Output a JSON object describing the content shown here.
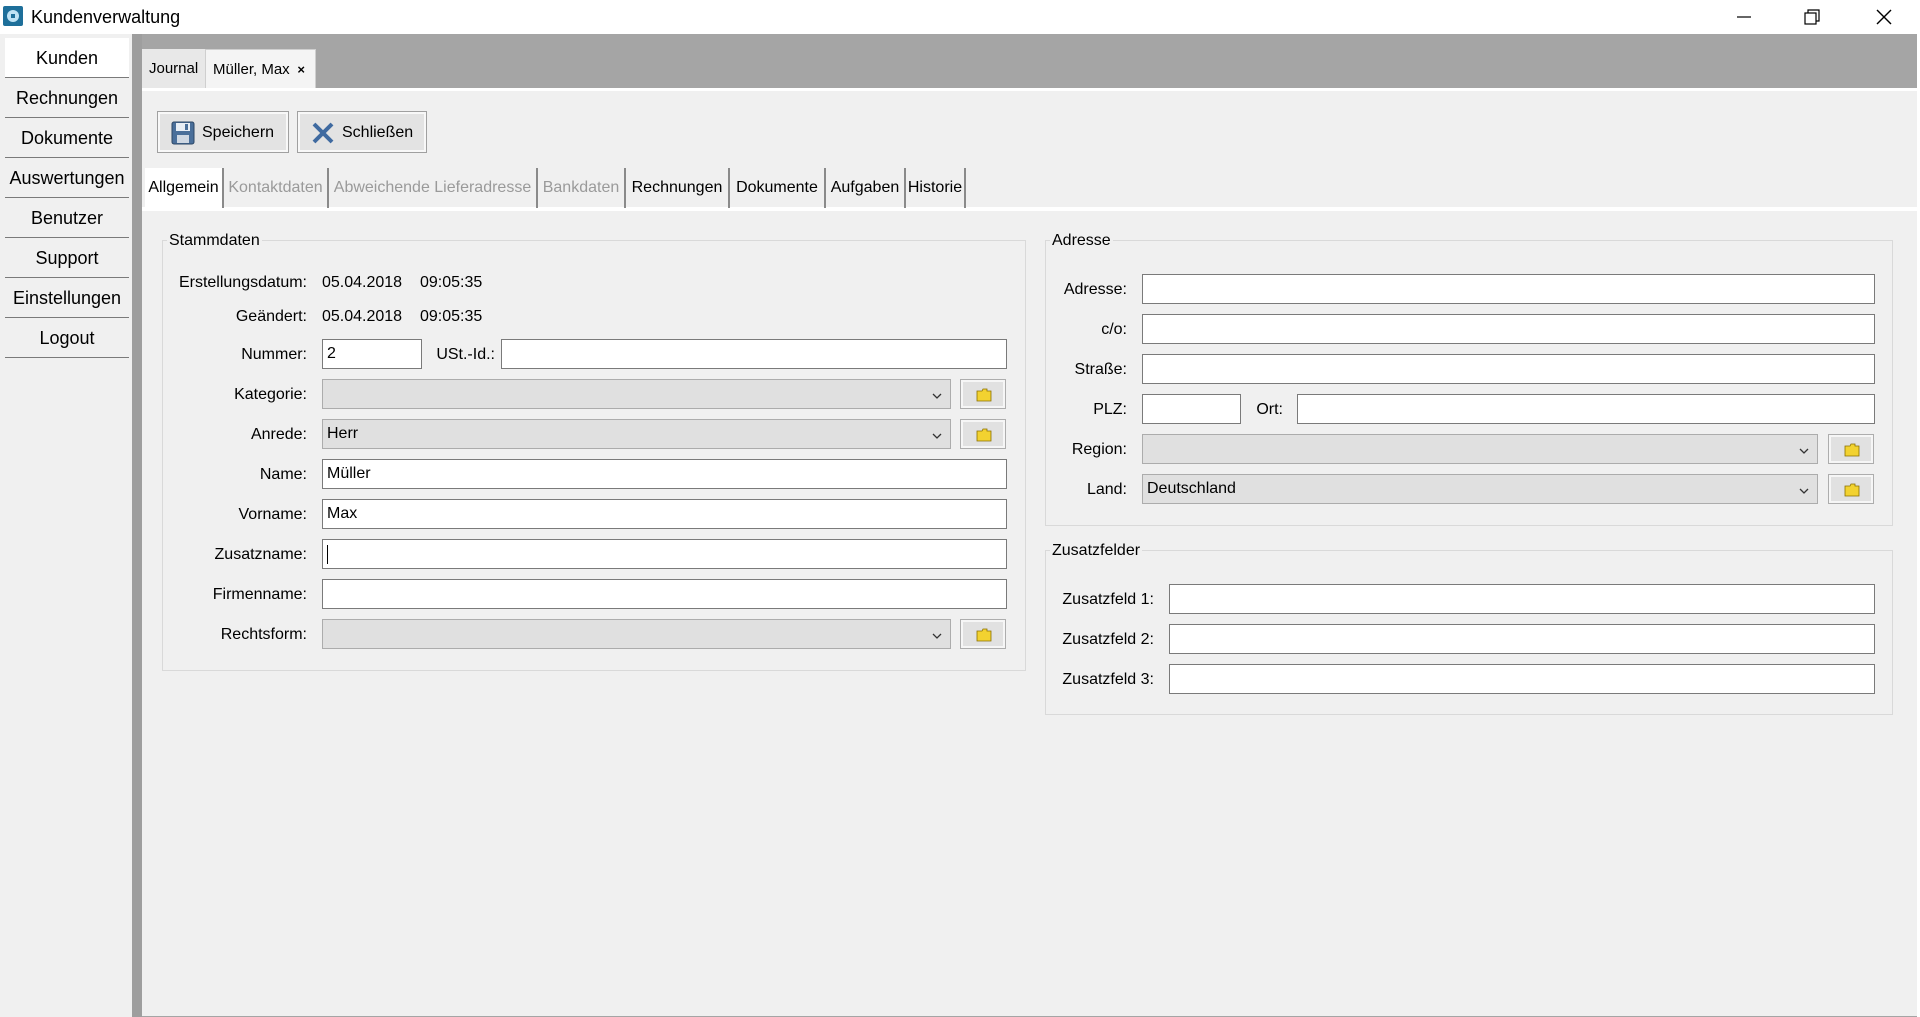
{
  "window": {
    "title": "Kundenverwaltung"
  },
  "nav": {
    "items": [
      {
        "label": "Kunden"
      },
      {
        "label": "Rechnungen"
      },
      {
        "label": "Dokumente"
      },
      {
        "label": "Auswertungen"
      },
      {
        "label": "Benutzer"
      },
      {
        "label": "Support"
      },
      {
        "label": "Einstellungen"
      },
      {
        "label": "Logout"
      }
    ]
  },
  "doc_tabs": {
    "journal": "Journal",
    "active": "Müller, Max",
    "close_glyph": "×"
  },
  "toolbar": {
    "save_label": "Speichern",
    "close_label": "Schließen"
  },
  "sub_tabs": [
    {
      "label": "Allgemein",
      "state": "active"
    },
    {
      "label": "Kontaktdaten",
      "state": "disabled"
    },
    {
      "label": "Abweichende Lieferadresse",
      "state": "disabled"
    },
    {
      "label": "Bankdaten",
      "state": "disabled"
    },
    {
      "label": "Rechnungen",
      "state": "enabled"
    },
    {
      "label": "Dokumente",
      "state": "enabled"
    },
    {
      "label": "Aufgaben",
      "state": "enabled"
    },
    {
      "label": "Historie",
      "state": "enabled"
    }
  ],
  "stammdaten": {
    "title": "Stammdaten",
    "created_label": "Erstellungsdatum:",
    "created_date": "05.04.2018",
    "created_time": "09:05:35",
    "changed_label": "Geändert:",
    "changed_date": "05.04.2018",
    "changed_time": "09:05:35",
    "nummer_label": "Nummer:",
    "nummer_value": "2",
    "ustid_label": "USt.-Id.:",
    "ustid_value": "",
    "kategorie_label": "Kategorie:",
    "kategorie_value": "",
    "anrede_label": "Anrede:",
    "anrede_value": "Herr",
    "name_label": "Name:",
    "name_value": "Müller",
    "vorname_label": "Vorname:",
    "vorname_value": "Max",
    "zusatzname_label": "Zusatzname:",
    "zusatzname_value": "",
    "firmenname_label": "Firmenname:",
    "firmenname_value": "",
    "rechtsform_label": "Rechtsform:",
    "rechtsform_value": ""
  },
  "adresse": {
    "title": "Adresse",
    "adresse_label": "Adresse:",
    "adresse_value": "",
    "co_label": "c/o:",
    "co_value": "",
    "strasse_label": "Straße:",
    "strasse_value": "",
    "plz_label": "PLZ:",
    "plz_value": "",
    "ort_label": "Ort:",
    "ort_value": "",
    "region_label": "Region:",
    "region_value": "",
    "land_label": "Land:",
    "land_value": "Deutschland"
  },
  "zusatzfelder": {
    "title": "Zusatzfelder",
    "f1_label": "Zusatzfeld 1:",
    "f1_value": "",
    "f2_label": "Zusatzfeld 2:",
    "f2_value": "",
    "f3_label": "Zusatzfeld 3:",
    "f3_value": ""
  },
  "colors": {
    "doc_area_bg": "#a5a5a5",
    "splitter": "#9e9e9e",
    "panel_bg": "#f0f0f0",
    "disabled_text": "#9a9a9a",
    "folder_icon": "#f2d230"
  },
  "icons": {
    "app": "customer-app-icon",
    "save": "floppy-disk-icon",
    "close": "x-close-icon",
    "lookup": "folder-icon",
    "dropdown": "chevron-down-icon"
  }
}
